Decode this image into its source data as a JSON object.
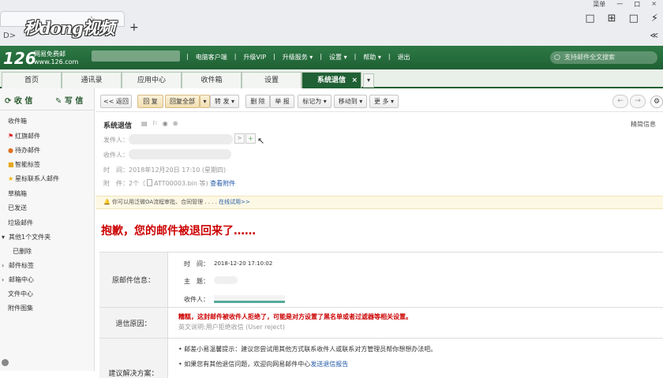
{
  "browser": {
    "titlebar_right_items": [
      "菜单",
      "一",
      "口",
      "×"
    ],
    "logo_overlay": "秒dong视频",
    "nav_arrow": "D>",
    "new_tab": "+",
    "tab_icon": "☆",
    "right_icons": [
      "□",
      "⊞",
      "□",
      "⚡"
    ],
    "right_icon_2": "≪"
  },
  "mail_header": {
    "brand": "126",
    "brand_sub_1": "网易免费邮",
    "brand_sub_2": "www.126.com",
    "links": [
      "|",
      "电脑客户端",
      "|",
      "升级VIP",
      "|",
      "升级服务 ▾",
      "|",
      "设置 ▾",
      "|",
      "帮助 ▾",
      "|",
      "退出"
    ],
    "search_placeholder": "支持邮件全文搜索",
    "search_icon": "○"
  },
  "tabs": [
    {
      "label": "首页"
    },
    {
      "label": "通讯录"
    },
    {
      "label": "应用中心"
    },
    {
      "label": "收件箱"
    },
    {
      "label": "设置"
    },
    {
      "label": "系统退信",
      "close": "×"
    }
  ],
  "tab_dropdown": "▾",
  "sidebar": {
    "receive": "收 信",
    "write": "写 信",
    "items": [
      {
        "label": "收件箱",
        "icon": ""
      },
      {
        "label": "红旗邮件",
        "icon": "⚑"
      },
      {
        "label": "待办邮件",
        "icon": "●"
      },
      {
        "label": "智能标签",
        "icon": "■"
      },
      {
        "label": "星标联系人邮件",
        "icon": "★"
      },
      {
        "label": "草稿箱",
        "icon": ""
      },
      {
        "label": "已发送",
        "icon": ""
      },
      {
        "label": "垃圾邮件",
        "icon": ""
      },
      {
        "label": "其他1个文件夹",
        "icon": "▾"
      },
      {
        "label": "已删除",
        "icon": ""
      },
      {
        "label": "邮件标签",
        "icon": "›"
      },
      {
        "label": "邮箱中心",
        "icon": "›"
      },
      {
        "label": "文件中心",
        "icon": ""
      },
      {
        "label": "附件图集",
        "icon": ""
      }
    ]
  },
  "toolbar": {
    "back": "<< 返回",
    "reply": "回 复",
    "reply_all": "回复全部",
    "reply_all_arrow": "▾",
    "forward": "转 发 ▾",
    "delete": "删 除",
    "report": "举 报",
    "mark_as": "标记为 ▾",
    "move_to": "移动到 ▾",
    "more": "更 多 ▾",
    "prev": "←",
    "next": "→",
    "settings_icon": "⚙"
  },
  "message": {
    "subject": "系统退信",
    "subject_icons": [
      "▤",
      "⚐",
      "◉",
      "⊕"
    ],
    "simple_info": "精简信息",
    "from_label": "发件人：",
    "from_arrow": ">",
    "from_add": "+",
    "cursor": "↖",
    "to_label": "收件人：",
    "time_label": "时　间：",
    "time_value": "2018年12月20日 17:10 (星期四)",
    "attach_label": "附　件：",
    "attach_count": "2个（",
    "attach_name": "ATT00003.bin 等)",
    "attach_link": "查看附件"
  },
  "notice": {
    "text": "你可以用泛微OA流程审批、合同管理 . . . .",
    "link": "在线试用>>"
  },
  "bounce": {
    "sorry": "抱歉，您的邮件被退回来了……",
    "orig_label": "原邮件信息：",
    "time_label": "时　间：",
    "time_value": "2018-12-20 17:10:02",
    "subject_label": "主　题：",
    "to_label": "收件人：",
    "reason_label": "退信原因：",
    "reason_text": "糟糕，这封邮件被收件人拒绝了，可能是对方设置了黑名单或者过滤器等相关设置。",
    "reason_en": "英文说明:用户拒绝收信 (User reject)",
    "solution_label": "建议解决方案：",
    "suggestion_1": "• 邮差小易温馨提示：建议您尝试用其他方式联系收件人或联系对方管理员帮你想想办法吧。",
    "suggestion_2_text": "• 如果您有其他退信问题，欢迎向网易邮件中心",
    "suggestion_2_link": "发送退信报告"
  }
}
